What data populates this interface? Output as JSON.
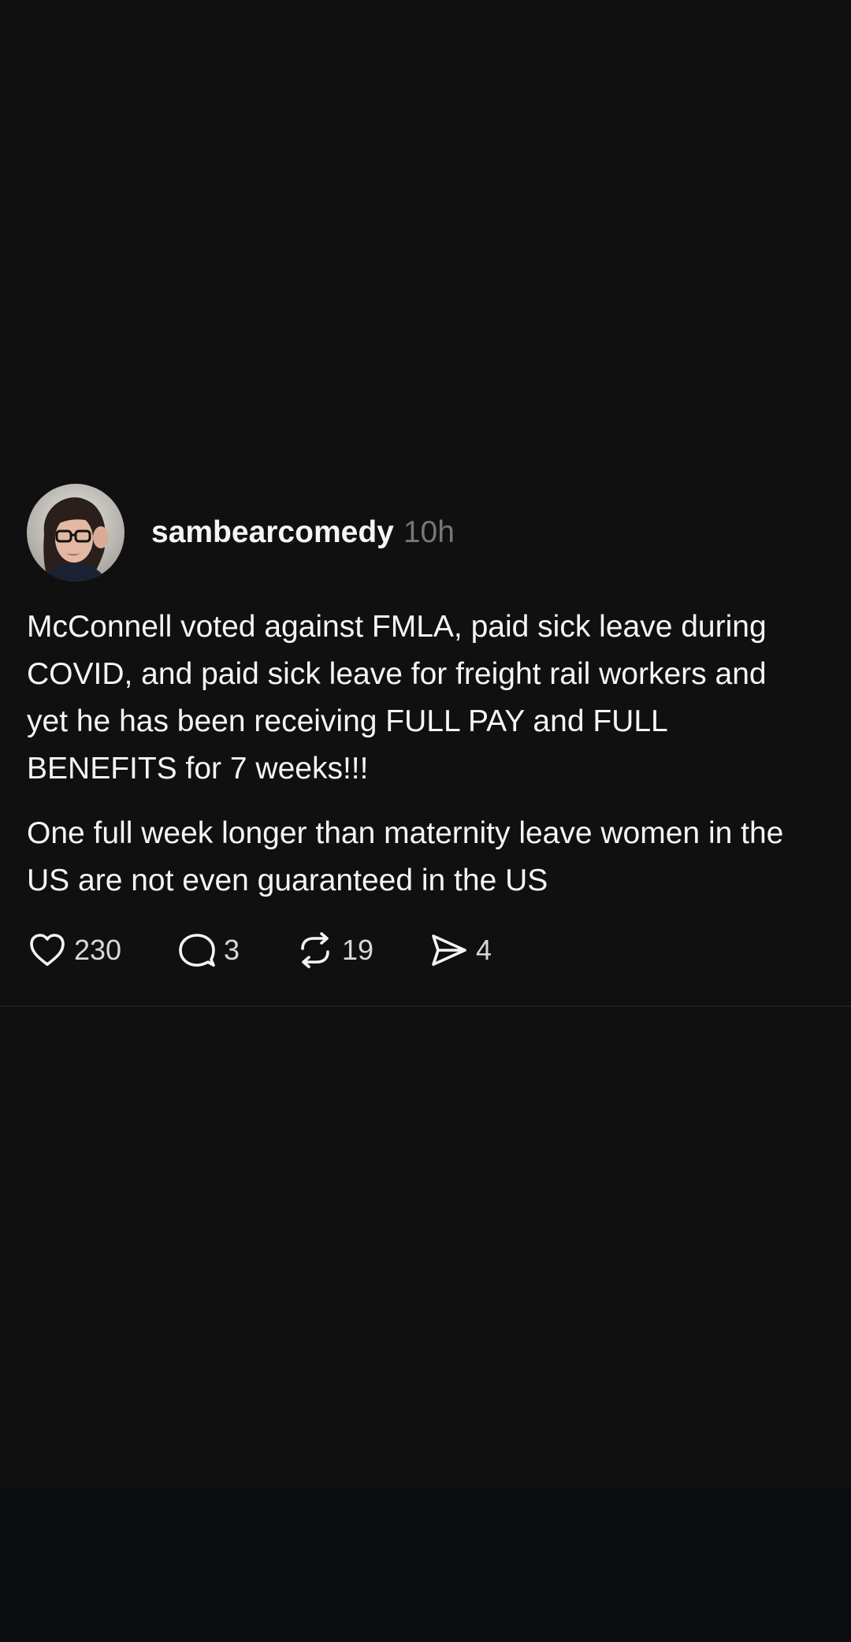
{
  "post": {
    "author": {
      "username": "sambearcomedy",
      "time": "10h",
      "avatar_icon": "profile-photo"
    },
    "body": {
      "paragraphs": [
        "McConnell voted against FMLA, paid sick leave during COVID, and paid sick leave for freight rail workers and yet he has been receiving FULL PAY and FULL BENEFITS for 7 weeks!!!",
        "One full week longer than maternity leave women in the US are not even guaranteed in the US"
      ]
    },
    "actions": {
      "likes": "230",
      "replies": "3",
      "reposts": "19",
      "shares": "4",
      "icons": [
        "heart-icon",
        "comment-icon",
        "repost-icon",
        "send-icon"
      ]
    }
  },
  "colors": {
    "background": "#101010",
    "bottom_bar": "#0b0d11",
    "text_primary": "#f3f5f7",
    "text_secondary": "#777777"
  }
}
